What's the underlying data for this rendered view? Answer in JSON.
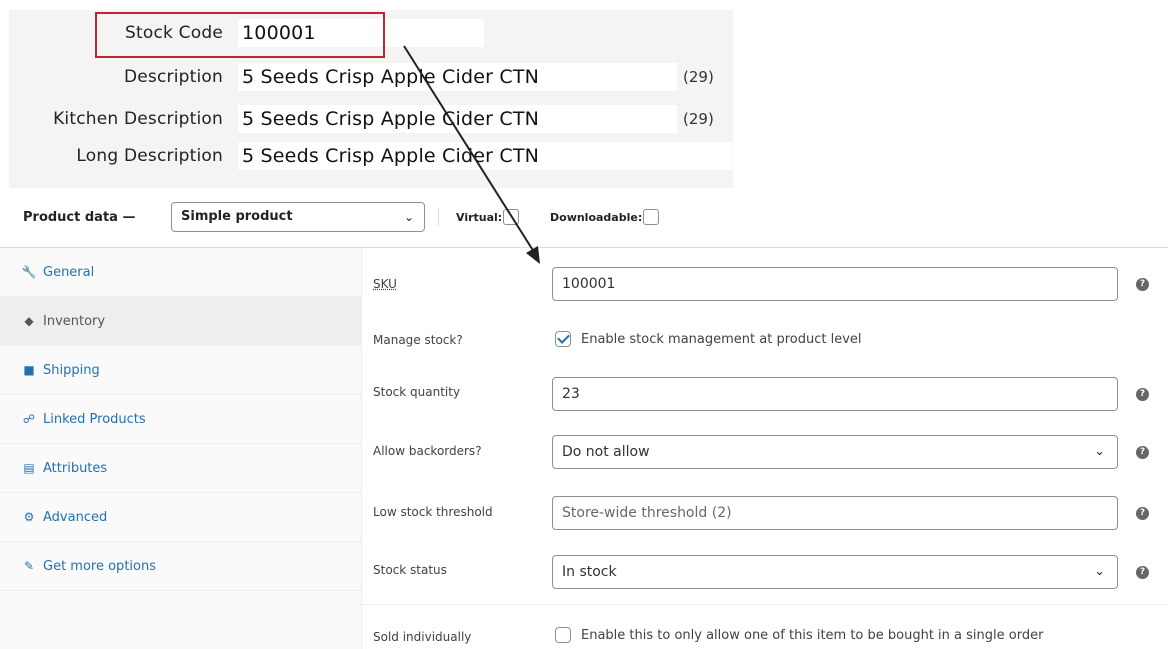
{
  "stock_panel": {
    "rows": [
      {
        "label": "Stock Code",
        "value": "100001",
        "count": ""
      },
      {
        "label": "Description",
        "value": "5 Seeds Crisp Apple Cider CTN",
        "count": "(29)"
      },
      {
        "label": "Kitchen Description",
        "value": "5 Seeds Crisp Apple Cider CTN",
        "count": "(29)"
      },
      {
        "label": "Long Description",
        "value": "5 Seeds Crisp Apple Cider CTN",
        "count": ""
      }
    ],
    "highlight_color": "#c0262d"
  },
  "product_data": {
    "title": "Product data —",
    "type_select": "Simple product",
    "virtual_label": "Virtual:",
    "downloadable_label": "Downloadable:"
  },
  "tabs": [
    {
      "label": "General",
      "icon": "wrench-icon"
    },
    {
      "label": "Inventory",
      "icon": "tag-icon"
    },
    {
      "label": "Shipping",
      "icon": "truck-icon"
    },
    {
      "label": "Linked Products",
      "icon": "link-icon"
    },
    {
      "label": "Attributes",
      "icon": "list-icon"
    },
    {
      "label": "Advanced",
      "icon": "gear-icon"
    },
    {
      "label": "Get more options",
      "icon": "plugin-icon"
    }
  ],
  "fields": {
    "sku": {
      "label": "SKU",
      "value": "100001"
    },
    "manage_stock": {
      "label": "Manage stock?",
      "checkbox_label": "Enable stock management at product level",
      "checked": true
    },
    "stock_quantity": {
      "label": "Stock quantity",
      "value": "23"
    },
    "backorders": {
      "label": "Allow backorders?",
      "value": "Do not allow"
    },
    "low_stock": {
      "label": "Low stock threshold",
      "placeholder": "Store-wide threshold (2)"
    },
    "stock_status": {
      "label": "Stock status",
      "value": "In stock"
    },
    "sold_individually": {
      "label": "Sold individually",
      "checkbox_label": "Enable this to only allow one of this item to be bought in a single order",
      "checked": false
    }
  },
  "colors": {
    "accent": "#2271b1",
    "tab_active_bg": "#eeeeee"
  }
}
